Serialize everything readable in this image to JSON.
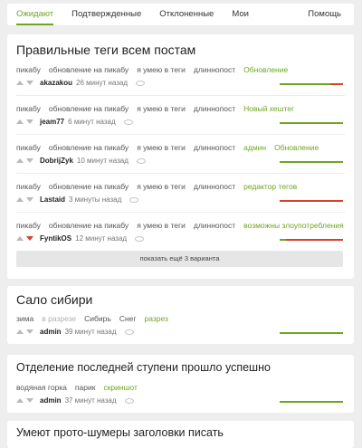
{
  "tabs": [
    {
      "label": "Ожидают"
    },
    {
      "label": "Подтвержденные"
    },
    {
      "label": "Отклоненные"
    },
    {
      "label": "Мои"
    }
  ],
  "help_label": "Помощь",
  "post1": {
    "title": "Правильные теги всем постам",
    "variants": [
      {
        "tags": [
          "пикабу",
          "обновление на пикабу",
          "я умею в теги",
          "длиннопост"
        ],
        "new_tags": [
          "Обновление"
        ],
        "author": "akazakou",
        "time": "26 минут назад",
        "approval": 0.8,
        "downvoted": false
      },
      {
        "tags": [
          "пикабу",
          "обновление на пикабу",
          "я умею в теги",
          "длиннопост"
        ],
        "new_tags": [
          "Новый хештег"
        ],
        "author": "jeam77",
        "time": "6 минут назад",
        "approval": 1.0,
        "downvoted": false
      },
      {
        "tags": [
          "пикабу",
          "обновление на пикабу",
          "я умею в теги",
          "длиннопост"
        ],
        "new_tags": [
          "админ",
          "Обновление"
        ],
        "author": "DobrijZyk",
        "time": "10 минут назад",
        "approval": 1.0,
        "downvoted": false
      },
      {
        "tags": [
          "пикабу",
          "обновление на пикабу",
          "я умею в теги",
          "длиннопост"
        ],
        "new_tags": [
          "редактор тегов"
        ],
        "author": "Lastaid",
        "time": "3 минуты назад",
        "approval": 0.0,
        "downvoted": false
      },
      {
        "tags": [
          "пикабу",
          "обновление на пикабу",
          "я умею в теги",
          "длиннопост"
        ],
        "new_tags": [
          "возможны злоупотребления"
        ],
        "author": "FyntikOS",
        "time": "12 минут назад",
        "approval": 0.1,
        "downvoted": true
      }
    ],
    "more_label": "показать ещё 3 варианта"
  },
  "post2": {
    "title": "Сало сибири",
    "tags": [
      "зима"
    ],
    "removed_tags": [
      "в разрезе"
    ],
    "tags_after": [
      "Сибирь",
      "Снег"
    ],
    "new_tags": [
      "разрез"
    ],
    "author": "admin",
    "time": "39 минут назад",
    "approval": 1.0
  },
  "post3": {
    "title": "Отделение последней ступени прошло успешно",
    "tags": [
      "водяная горка",
      "парик"
    ],
    "new_tags": [
      "скриншот"
    ],
    "author": "admin",
    "time": "37 минут назад",
    "approval": 1.0
  },
  "post4": {
    "title": "Умеют прото-шумеры заголовки писать"
  },
  "colors": {
    "green": "#6fa522",
    "red": "#d6402f",
    "background": "#eeeeee"
  }
}
